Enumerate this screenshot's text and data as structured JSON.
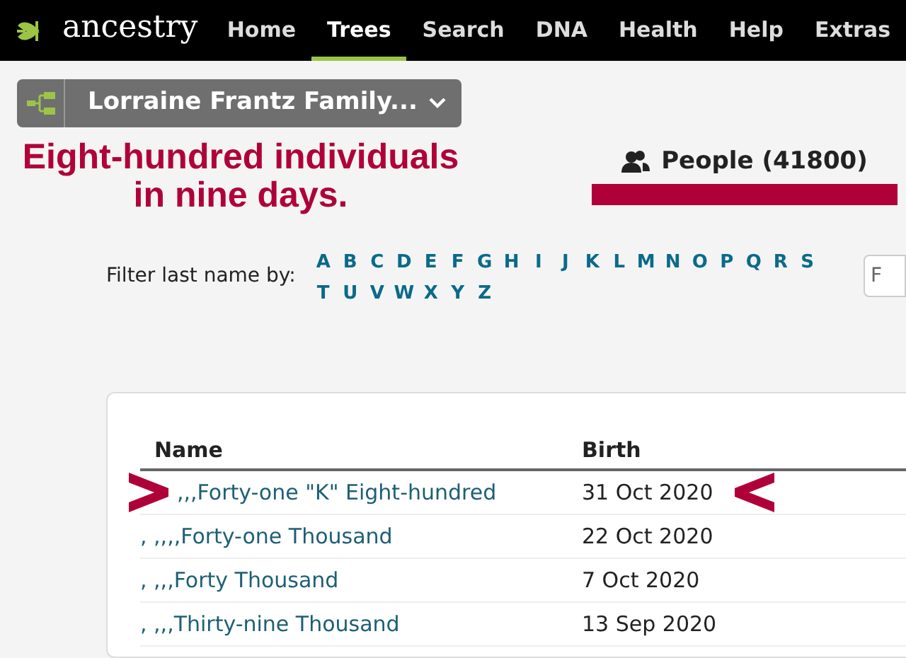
{
  "nav": {
    "logo": "ancestry",
    "items": [
      {
        "label": "Home",
        "selected": false
      },
      {
        "label": "Trees",
        "selected": true
      },
      {
        "label": "Search",
        "selected": false
      },
      {
        "label": "DNA",
        "selected": false
      },
      {
        "label": "Health",
        "selected": false
      },
      {
        "label": "Help",
        "selected": false
      },
      {
        "label": "Extras",
        "selected": false
      }
    ]
  },
  "tree_selector": {
    "label": "Lorraine Frantz Family..."
  },
  "annotation": {
    "headline": "Eight-hundred individuals in nine days."
  },
  "people_tab": {
    "label": "People (41800)"
  },
  "filter": {
    "label": "Filter last name by:",
    "letters": [
      "A",
      "B",
      "C",
      "D",
      "E",
      "F",
      "G",
      "H",
      "I",
      "J",
      "K",
      "L",
      "M",
      "N",
      "O",
      "P",
      "Q",
      "R",
      "S",
      "T",
      "U",
      "V",
      "W",
      "X",
      "Y",
      "Z"
    ],
    "search_placeholder": "F"
  },
  "table": {
    "columns": [
      "Name",
      "Birth"
    ],
    "rows": [
      {
        "name": ",,,Forty-one \"K\" Eight-hundred",
        "birth": "31 Oct 2020",
        "highlighted": true
      },
      {
        "name": ", ,,,,Forty-one Thousand",
        "birth": "22 Oct 2020",
        "highlighted": false
      },
      {
        "name": ", ,,,Forty Thousand",
        "birth": "7 Oct 2020",
        "highlighted": false
      },
      {
        "name": ", ,,,Thirty-nine Thousand",
        "birth": "13 Sep 2020",
        "highlighted": false
      }
    ]
  }
}
